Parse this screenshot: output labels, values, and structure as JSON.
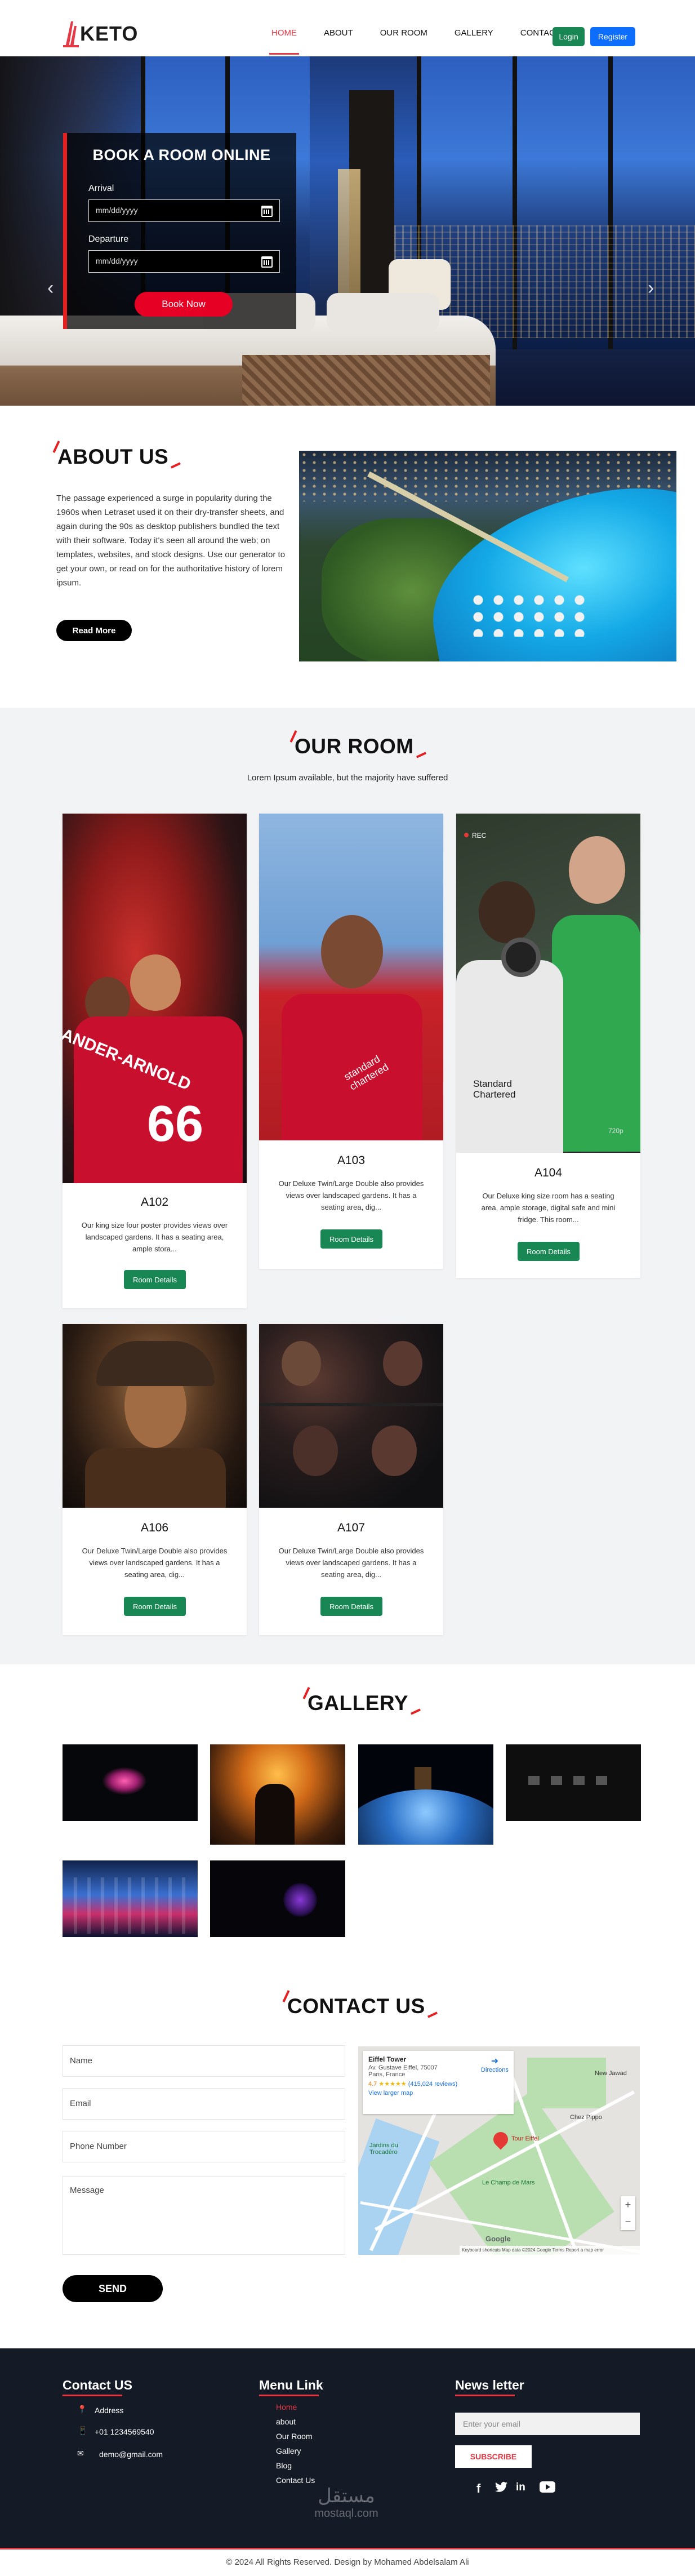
{
  "brand": {
    "name": "KETO"
  },
  "nav": {
    "items": [
      {
        "label": "HOME",
        "active": true
      },
      {
        "label": "ABOUT",
        "active": false
      },
      {
        "label": "OUR ROOM",
        "active": false
      },
      {
        "label": "GALLERY",
        "active": false
      },
      {
        "label": "CONTACT US",
        "active": false
      }
    ],
    "login": "Login",
    "register": "Register"
  },
  "booking": {
    "title": "BOOK A ROOM ONLINE",
    "arrival_label": "Arrival",
    "arrival_placeholder": "mm/dd/yyyy",
    "departure_label": "Departure",
    "departure_placeholder": "mm/dd/yyyy",
    "button": "Book Now"
  },
  "about": {
    "title": "ABOUT US",
    "text": "The passage experienced a surge in popularity during the 1960s when Letraset used it on their dry-transfer sheets, and again during the 90s as desktop publishers bundled the text with their software. Today it's seen all around the web; on templates, websites, and stock designs. Use our generator to get your own, or read on for the authoritative history of lorem ipsum.",
    "button": "Read More"
  },
  "rooms": {
    "title": "OUR ROOM",
    "subtitle": "Lorem Ipsum available, but the majority have suffered",
    "cards": [
      {
        "name": "A102",
        "desc": "Our king size four poster provides views over landscaped gardens. It has a seating area, ample stora...",
        "button": "Room Details"
      },
      {
        "name": "A103",
        "desc": "Our Deluxe Twin/Large Double also provides views over landscaped gardens. It has a seating area, dig...",
        "button": "Room Details"
      },
      {
        "name": "A104",
        "desc": "Our Deluxe king size room has a seating area, ample storage, digital safe and mini fridge. This room...",
        "button": "Room Details"
      },
      {
        "name": "A106",
        "desc": "Our Deluxe Twin/Large Double also provides views over landscaped gardens. It has a seating area, dig...",
        "button": "Room Details"
      },
      {
        "name": "A107",
        "desc": "Our Deluxe Twin/Large Double also provides views over landscaped gardens. It has a seating area, dig...",
        "button": "Room Details"
      }
    ],
    "image_text": {
      "a102_jersey": "ANDER-ARNOLD",
      "a102_number": "66",
      "a103_sponsor": "standard chartered",
      "a104_rec": "REC",
      "a104_sponsor": "Standard Chartered",
      "a104_quality": "720p"
    }
  },
  "gallery": {
    "title": "GALLERY"
  },
  "contact": {
    "title": "CONTACT US",
    "name_placeholder": "Name",
    "email_placeholder": "Email",
    "phone_placeholder": "Phone Number",
    "message_placeholder": "Message",
    "button": "SEND",
    "map": {
      "place": "Eiffel Tower",
      "address": "Av. Gustave Eiffel, 75007 Paris, France",
      "rating": "4.7",
      "reviews": "(415,024 reviews)",
      "link": "View larger map",
      "directions": "Directions",
      "pin_label": "Tour Eiffel",
      "labels": [
        "Chez Pippo",
        "New Jawad",
        "Le Champ de Mars",
        "Jardins du Trocadéro"
      ],
      "attribution": "Keyboard shortcuts   Map data ©2024 Google   Terms   Report a map error",
      "google": "Google"
    }
  },
  "footer": {
    "contact_title": "Contact US",
    "address": "Address",
    "phone": "+01 1234569540",
    "email": "demo@gmail.com",
    "menu_title": "Menu Link",
    "menu": [
      "Home",
      "about",
      "Our Room",
      "Gallery",
      "Blog",
      "Contact Us"
    ],
    "news_title": "News letter",
    "news_placeholder": "Enter your email",
    "subscribe": "SUBSCRIBE",
    "social": [
      "f",
      "t",
      "in",
      "yt"
    ],
    "watermark_ar": "مستقل",
    "watermark": "mostaql.com",
    "copyright": "© 2024 All Rights Reserved. Design by Mohamed Abdelsalam Ali"
  },
  "colors": {
    "accent": "#e63946",
    "green": "#198754",
    "blue": "#0d6efd",
    "footer_bg": "#141a26",
    "section_bg": "#f2f3f5"
  }
}
